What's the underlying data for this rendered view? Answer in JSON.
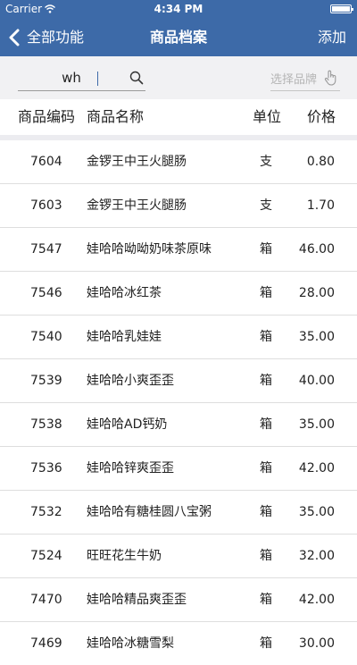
{
  "status_bar": {
    "carrier": "Carrier",
    "time": "4:34 PM"
  },
  "nav": {
    "back_label": "全部功能",
    "title": "商品档案",
    "add_label": "添加"
  },
  "search": {
    "value": "wh",
    "brand_placeholder": "选择品牌"
  },
  "table": {
    "headers": {
      "code": "商品编码",
      "name": "商品名称",
      "unit": "单位",
      "price": "价格"
    },
    "rows": [
      {
        "code": "7604",
        "name": "金锣王中王火腿肠",
        "unit": "支",
        "price": "0.80"
      },
      {
        "code": "7603",
        "name": "金锣王中王火腿肠",
        "unit": "支",
        "price": "1.70"
      },
      {
        "code": "7547",
        "name": "娃哈哈呦呦奶味茶原味",
        "unit": "箱",
        "price": "46.00"
      },
      {
        "code": "7546",
        "name": "娃哈哈冰红茶",
        "unit": "箱",
        "price": "28.00"
      },
      {
        "code": "7540",
        "name": "娃哈哈乳娃娃",
        "unit": "箱",
        "price": "35.00"
      },
      {
        "code": "7539",
        "name": "娃哈哈小爽歪歪",
        "unit": "箱",
        "price": "40.00"
      },
      {
        "code": "7538",
        "name": "娃哈哈AD钙奶",
        "unit": "箱",
        "price": "35.00"
      },
      {
        "code": "7536",
        "name": "娃哈哈锌爽歪歪",
        "unit": "箱",
        "price": "42.00"
      },
      {
        "code": "7532",
        "name": "娃哈哈有糖桂圆八宝粥",
        "unit": "箱",
        "price": "35.00"
      },
      {
        "code": "7524",
        "name": "旺旺花生牛奶",
        "unit": "箱",
        "price": "32.00"
      },
      {
        "code": "7470",
        "name": "娃哈哈精品爽歪歪",
        "unit": "箱",
        "price": "42.00"
      },
      {
        "code": "7469",
        "name": "娃哈哈冰糖雪梨",
        "unit": "箱",
        "price": "30.00"
      }
    ]
  }
}
